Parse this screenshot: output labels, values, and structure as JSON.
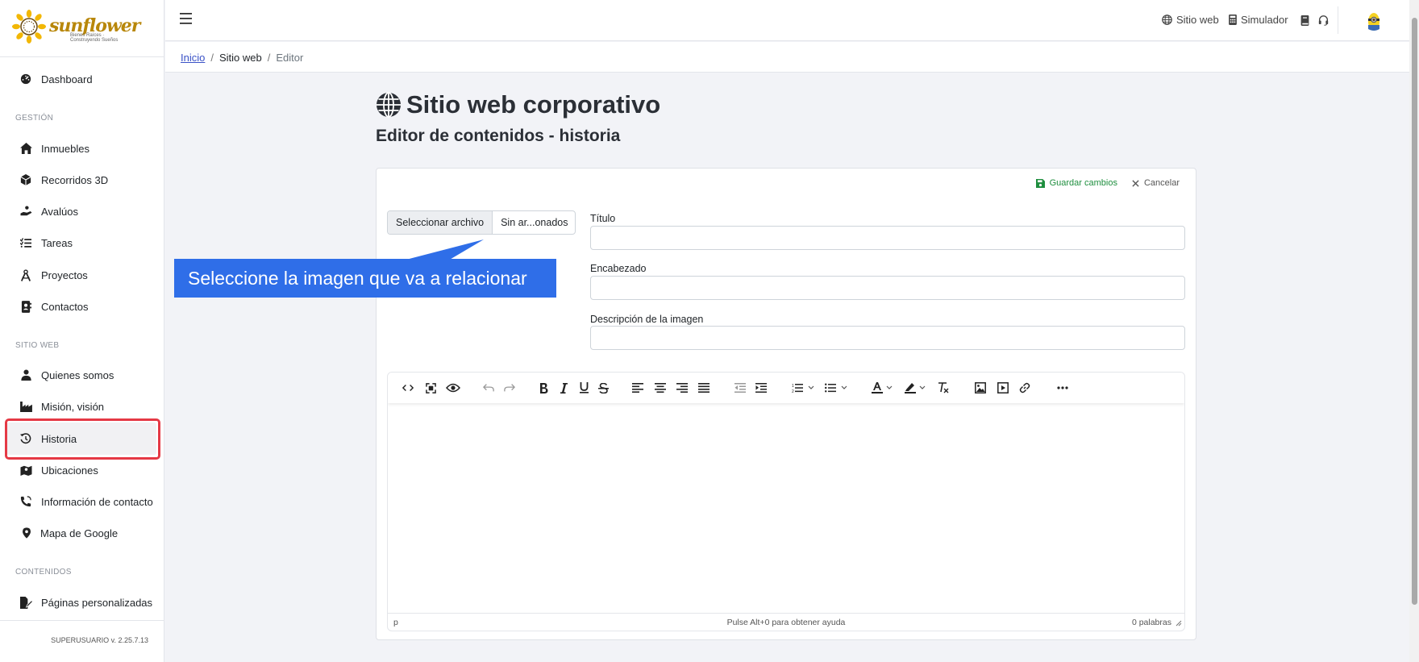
{
  "sidebar": {
    "logo_text": "sunflower",
    "logo_tagline": "Bienes Raíces · Construyendo Sueños",
    "dashboard": "Dashboard",
    "sections": {
      "gestion": "GESTIÓN",
      "sitio_web": "SITIO WEB",
      "contenidos": "CONTENIDOS"
    },
    "gestion_items": [
      "Inmuebles",
      "Recorridos 3D",
      "Avalúos",
      "Tareas",
      "Proyectos",
      "Contactos"
    ],
    "sitio_items": [
      "Quienes somos",
      "Misión, visión",
      "Historia",
      "Ubicaciones",
      "Información de contacto",
      "Mapa de Google"
    ],
    "contenidos_items": [
      "Páginas personalizadas"
    ],
    "active_item": "Historia",
    "version": "SUPERUSUARIO v. 2.25.7.13"
  },
  "topbar": {
    "links": [
      "Sitio web",
      "Simulador"
    ]
  },
  "breadcrumb": {
    "home": "Inicio",
    "section": "Sitio web",
    "current": "Editor"
  },
  "page": {
    "title": "Sitio web corporativo",
    "subtitle": "Editor de contenidos - historia"
  },
  "card": {
    "save_label": "Guardar cambios",
    "cancel_label": "Cancelar",
    "file_button": "Seleccionar archivo",
    "file_name": "Sin ar...onados",
    "fields": {
      "titulo_label": "Título",
      "encabezado_label": "Encabezado",
      "descripcion_label": "Descripción de la imagen"
    }
  },
  "editor": {
    "status_path": "p",
    "status_help": "Pulse Alt+0 para obtener ayuda",
    "status_words": "0 palabras",
    "toolbar_icons": [
      "code-icon",
      "fullscreen-icon",
      "preview-icon",
      "undo-icon",
      "redo-icon",
      "bold-icon",
      "italic-icon",
      "underline-icon",
      "strikethrough-icon",
      "align-left-icon",
      "align-center-icon",
      "align-right-icon",
      "align-justify-icon",
      "outdent-icon",
      "indent-icon",
      "numbered-list-icon",
      "bullet-list-icon",
      "text-color-icon",
      "highlight-icon",
      "clear-format-icon",
      "image-icon",
      "media-icon",
      "link-icon",
      "more-icon"
    ]
  },
  "callout": {
    "text": "Seleccione la imagen que va a relacionar"
  },
  "colors": {
    "accent_blue": "#2f6ee8",
    "highlight_red": "#e53945",
    "save_green": "#1e8e3e",
    "link_blue": "#3a52c7"
  }
}
